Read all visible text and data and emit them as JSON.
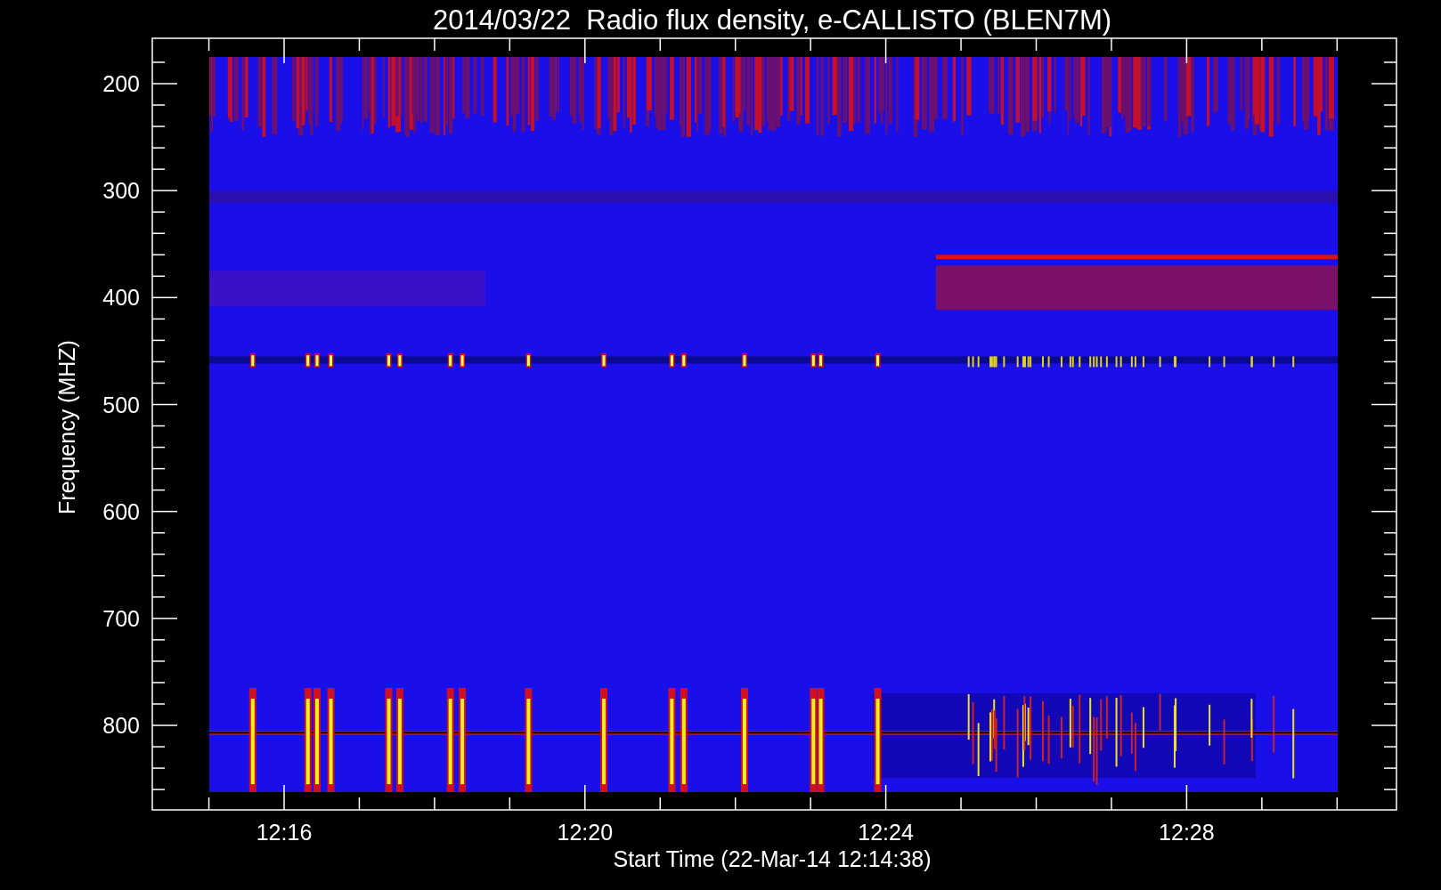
{
  "title": "2014/03/22  Radio flux density, e-CALLISTO (BLEN7M)",
  "y_axis": {
    "label": "Frequency (MHZ)",
    "ticks": [
      "200",
      "300",
      "400",
      "500",
      "600",
      "700",
      "800"
    ]
  },
  "x_axis": {
    "label": "Start Time (22-Mar-14 12:14:38)",
    "ticks": [
      "12:16",
      "12:20",
      "12:24",
      "12:28"
    ]
  }
}
